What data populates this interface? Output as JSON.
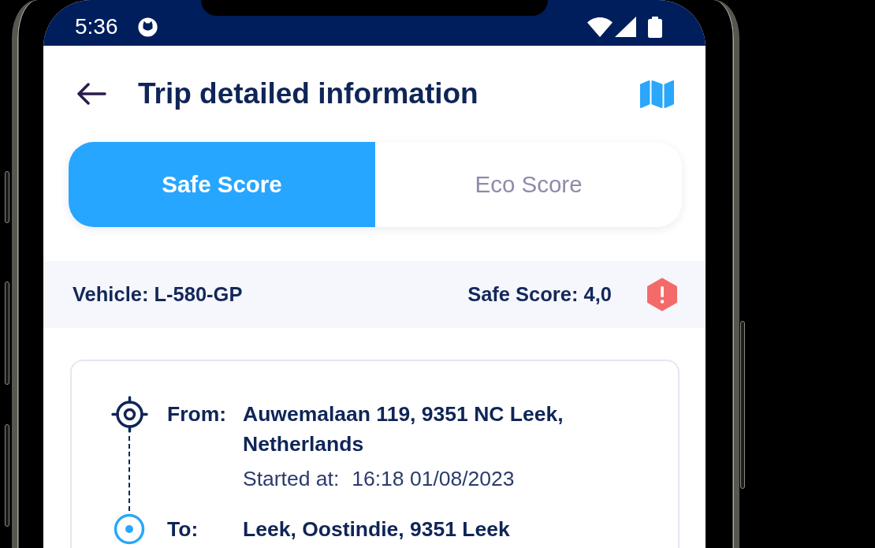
{
  "status_bar": {
    "time": "5:36"
  },
  "header": {
    "title": "Trip detailed information"
  },
  "tabs": [
    {
      "label": "Safe Score",
      "selected": true
    },
    {
      "label": "Eco Score",
      "selected": false
    }
  ],
  "summary": {
    "vehicle": "Vehicle: L-580-GP",
    "score": "Safe Score: 4,0"
  },
  "route": {
    "stops": [
      {
        "kind": "origin",
        "label": "From:",
        "address": "Auwemalaan 119, 9351 NC Leek, Netherlands",
        "start_label": "Started at:",
        "start_time": "16:18 01/08/2023"
      },
      {
        "kind": "destination",
        "label": "To:",
        "address": "Leek, Oostindie, 9351 Leek"
      }
    ]
  }
}
